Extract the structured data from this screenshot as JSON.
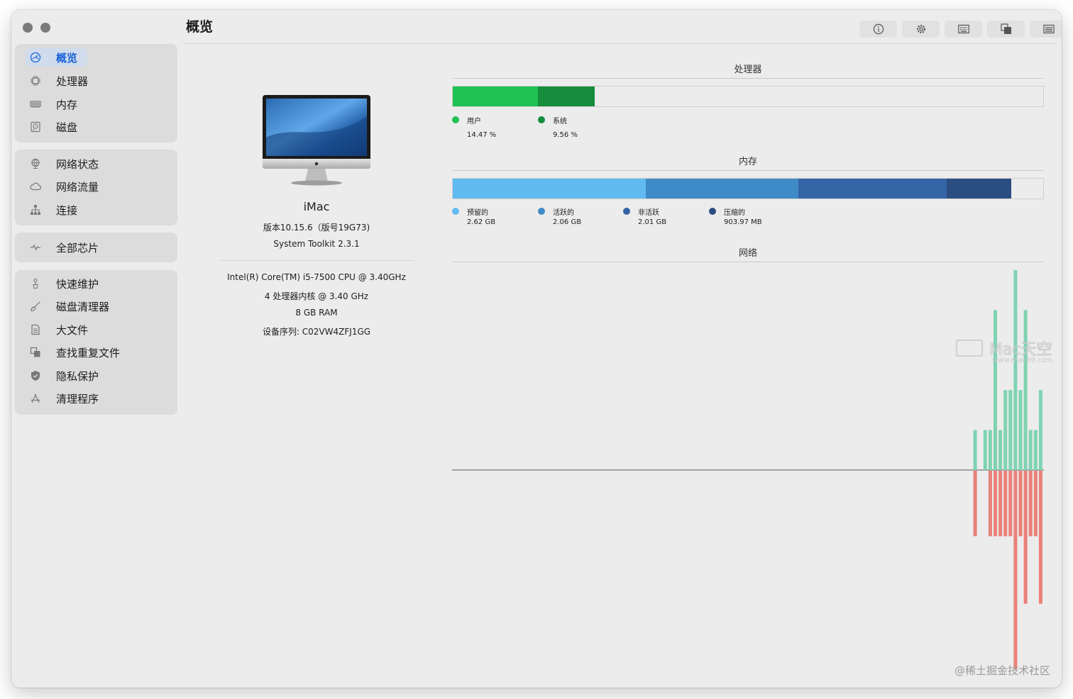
{
  "window": {
    "title": "概览"
  },
  "toolbar": {
    "buttons": [
      {
        "icon": "info-icon"
      },
      {
        "icon": "gear-icon"
      },
      {
        "icon": "keyboard-icon"
      },
      {
        "icon": "windows-icon"
      },
      {
        "icon": "list-icon"
      }
    ]
  },
  "sidebar": {
    "groups": [
      {
        "items": [
          {
            "label": "概览",
            "icon": "gauge-icon",
            "active": true
          },
          {
            "label": "处理器",
            "icon": "cpu-icon"
          },
          {
            "label": "内存",
            "icon": "memory-icon"
          },
          {
            "label": "磁盘",
            "icon": "disk-icon"
          }
        ]
      },
      {
        "items": [
          {
            "label": "网络状态",
            "icon": "globe-icon"
          },
          {
            "label": "网络流量",
            "icon": "cloud-icon"
          },
          {
            "label": "连接",
            "icon": "network-tree-icon"
          }
        ]
      },
      {
        "items": [
          {
            "label": "全部芯片",
            "icon": "pulse-icon"
          }
        ]
      },
      {
        "items": [
          {
            "label": "快速维护",
            "icon": "broom-icon"
          },
          {
            "label": "磁盘清理器",
            "icon": "brush-icon"
          },
          {
            "label": "大文件",
            "icon": "document-icon"
          },
          {
            "label": "查找重复文件",
            "icon": "duplicate-icon"
          },
          {
            "label": "隐私保护",
            "icon": "shield-icon"
          },
          {
            "label": "清理程序",
            "icon": "app-store-icon"
          }
        ]
      }
    ]
  },
  "device": {
    "name": "iMac",
    "os_version": "版本10.15.6（版号19G73)",
    "app_version": "System Toolkit 2.3.1",
    "cpu": "Intel(R) Core(TM) i5-7500 CPU @ 3.40GHz",
    "cores": "4 处理器内核 @ 3.40 GHz",
    "ram": "8 GB RAM",
    "serial": "设备序列: C02VW4ZFJ1GG"
  },
  "processor": {
    "title": "处理器",
    "legend": [
      {
        "label": "用户",
        "value": "14.47 %",
        "percent": 14.47,
        "color": "#1fc253"
      },
      {
        "label": "系统",
        "value": "9.56 %",
        "percent": 9.56,
        "color": "#168d3c"
      }
    ]
  },
  "memory": {
    "title": "内存",
    "total_gb": 8,
    "legend": [
      {
        "label": "预留的",
        "value": "2.62 GB",
        "gb": 2.62,
        "color": "#62bbf0"
      },
      {
        "label": "活跃的",
        "value": "2.06 GB",
        "gb": 2.06,
        "color": "#3f8bc8"
      },
      {
        "label": "非活跃",
        "value": "2.01 GB",
        "gb": 2.01,
        "color": "#3465a6"
      },
      {
        "label": "压缩的",
        "value": "903.97 MB",
        "gb": 0.88,
        "color": "#2a4d82"
      }
    ]
  },
  "network": {
    "title": "网络",
    "colors": {
      "in": "#7fd3b2",
      "out": "#ea8079"
    },
    "bars": [
      {
        "up": 0.2,
        "down": 0.33
      },
      {
        "up": 0,
        "down": 0
      },
      {
        "up": 0.2,
        "down": 0
      },
      {
        "up": 0.2,
        "down": 0.33
      },
      {
        "up": 0.8,
        "down": 0.33
      },
      {
        "up": 0.2,
        "down": 0.33
      },
      {
        "up": 0.4,
        "down": 0.33
      },
      {
        "up": 0.4,
        "down": 0.33
      },
      {
        "up": 1.0,
        "down": 1.0
      },
      {
        "up": 0.4,
        "down": 0.33
      },
      {
        "up": 0.8,
        "down": 0.67
      },
      {
        "up": 0.2,
        "down": 0.33
      },
      {
        "up": 0.2,
        "down": 0.33
      },
      {
        "up": 0.4,
        "down": 0.67
      }
    ]
  },
  "footer": {
    "watermark": "@稀土掘金技术社区"
  },
  "overlay": {
    "watermark_logo": "Mac天空",
    "watermark_url": "www.mac69.com"
  }
}
